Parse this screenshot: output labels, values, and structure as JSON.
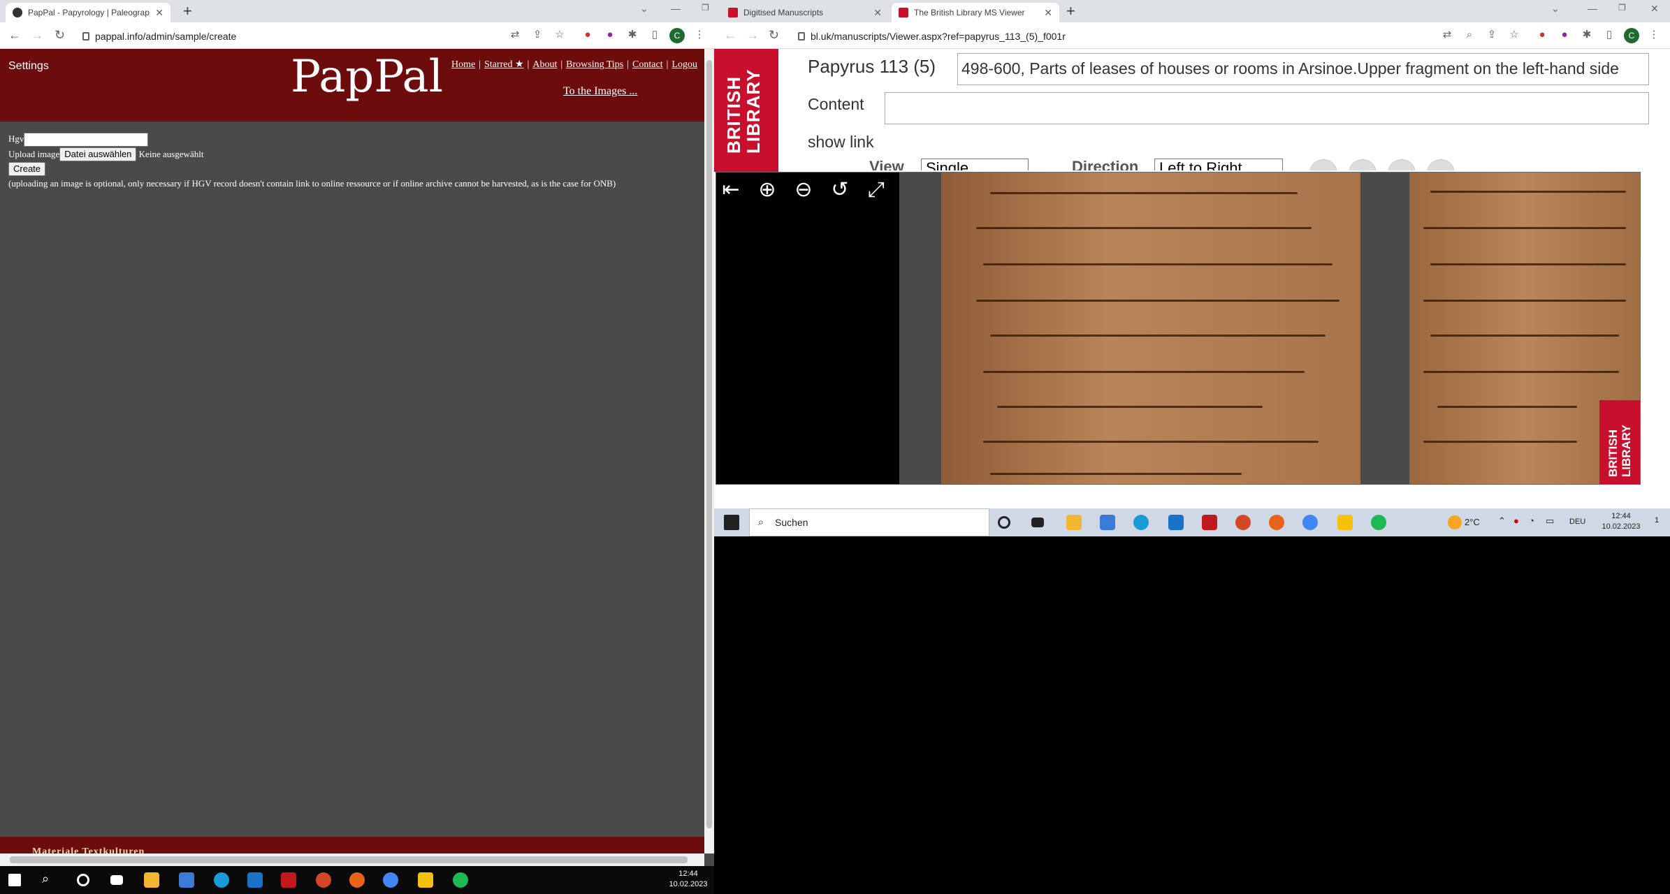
{
  "left_browser": {
    "tab_title": "PapPal - Papyrology | Paleograph",
    "url": "pappal.info/admin/sample/create"
  },
  "pappal": {
    "settings": "Settings",
    "logo": "PapPal",
    "nav": [
      "Home",
      "Starred ★",
      "About",
      "Browsing Tips",
      "Contact",
      "Logou"
    ],
    "to_images": "To the Images ...",
    "hgv_label": "Hgv",
    "hgv_value": "",
    "upload_label": "Upload image",
    "file_button": "Datei auswählen",
    "file_status": "Keine ausgewählt",
    "create_button": "Create",
    "note": "(uploading an image is optional, only necessary if HGV record doesn't contain link to online ressource or if online archive cannot be harvested, as is the case for ONB)",
    "footer": "Materiale Textkulturen"
  },
  "right_browser": {
    "tabs": [
      "Digitised Manuscripts",
      "The British Library MS Viewer"
    ],
    "url": "bl.uk/manuscripts/Viewer.aspx?ref=papyrus_113_(5)_f001r"
  },
  "bl": {
    "logo": [
      "BRITISH",
      "LIBRARY"
    ],
    "title": "Papyrus 113 (5)",
    "title_box": "498-600, Parts of leases of houses or rooms in Arsinoe.Upper fragment on the left-hand side",
    "content_label": "Content",
    "content_value": "",
    "show_link": "show link",
    "view_label": "View",
    "view_value": "Single",
    "direction_label": "Direction",
    "direction_value": "Left to Right"
  },
  "taskbar": {
    "search": "Suchen",
    "weather": "2°C",
    "lang": "DEU",
    "time": "12:44",
    "date": "10.02.2023",
    "notif": "1"
  },
  "colors": {
    "pappal_red": "#6d0c0c",
    "bl_red": "#c8102e",
    "pappal_body": "#4a4a4a"
  }
}
